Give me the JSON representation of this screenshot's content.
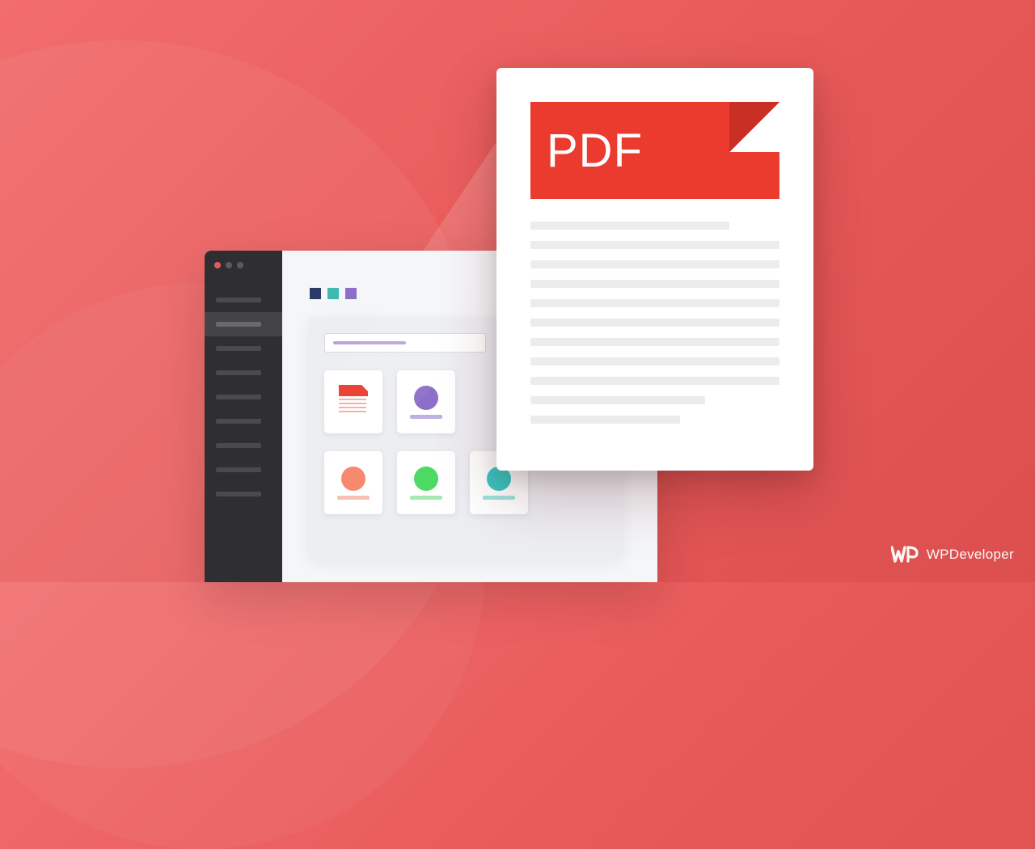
{
  "pdf": {
    "label": "PDF"
  },
  "watermark": {
    "brand_bold": "WP",
    "brand_light": "Developer"
  },
  "thumbnails": [
    {
      "type": "pdf"
    },
    {
      "type": "circle",
      "color": "purple"
    },
    {
      "type": "empty"
    },
    {
      "type": "circle",
      "color": "coral"
    },
    {
      "type": "circle",
      "color": "green"
    },
    {
      "type": "circle",
      "color": "teal"
    }
  ],
  "sidebar": {
    "item_count": 9,
    "active_index": 1
  },
  "color_tabs": [
    "navy",
    "teal",
    "purple"
  ],
  "colors": {
    "accent_red": "#ea3b2e",
    "bg_gradient_start": "#f26d6d",
    "bg_gradient_end": "#dc4f4f"
  }
}
